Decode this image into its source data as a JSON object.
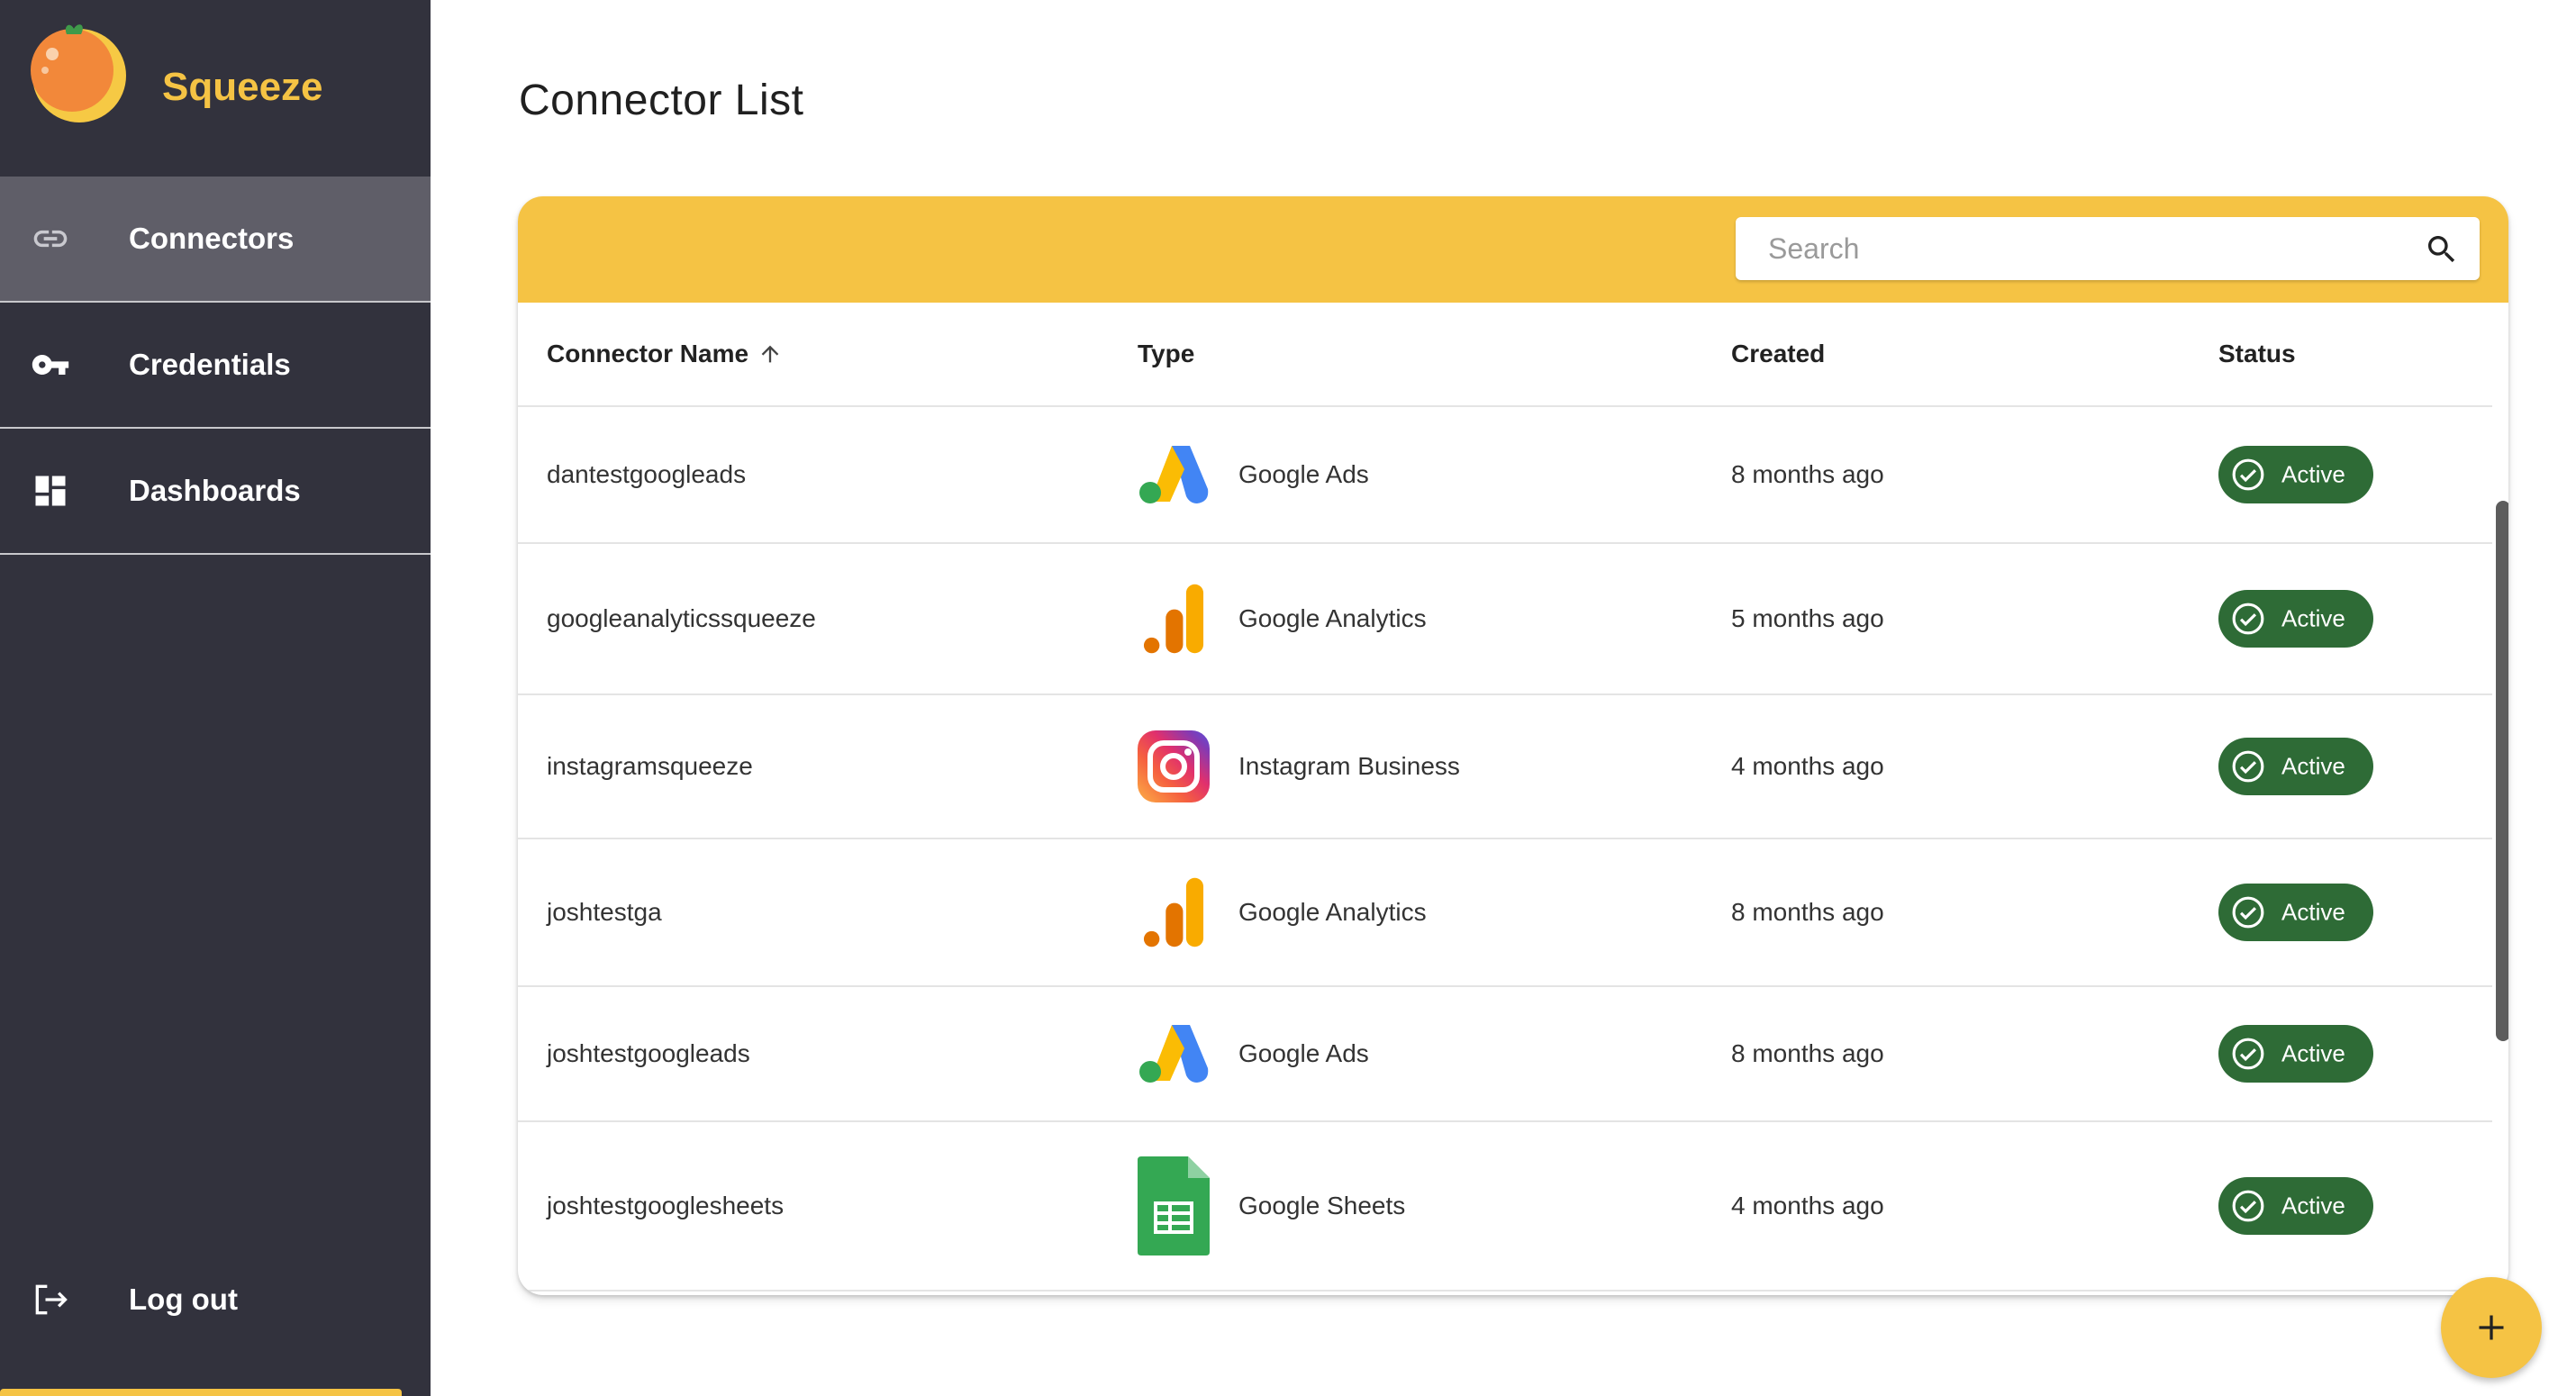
{
  "app": {
    "name": "Squeeze"
  },
  "colors": {
    "brand": "#f5c344",
    "sidebar": "#32323d",
    "sidebar_active": "#5f5e68",
    "status_active": "#2e6b36"
  },
  "sidebar": {
    "items": [
      {
        "label": "Connectors",
        "icon": "link-icon",
        "active": true
      },
      {
        "label": "Credentials",
        "icon": "key-icon",
        "active": false
      },
      {
        "label": "Dashboards",
        "icon": "dashboard-icon",
        "active": false
      }
    ],
    "logout": {
      "label": "Log out",
      "icon": "logout-icon"
    }
  },
  "page": {
    "title": "Connector List"
  },
  "search": {
    "placeholder": "Search",
    "value": ""
  },
  "table": {
    "columns": [
      "Connector Name",
      "Type",
      "Created",
      "Status"
    ],
    "sort": {
      "column": "Connector Name",
      "direction": "ascending"
    },
    "rows": [
      {
        "name": "dantestgoogleads",
        "type": "Google Ads",
        "type_icon": "google-ads-icon",
        "created": "8 months ago",
        "status": "Active"
      },
      {
        "name": "googleanalyticssqueeze",
        "type": "Google Analytics",
        "type_icon": "google-analytics-icon",
        "created": "5 months ago",
        "status": "Active"
      },
      {
        "name": "instagramsqueeze",
        "type": "Instagram Business",
        "type_icon": "instagram-icon",
        "created": "4 months ago",
        "status": "Active"
      },
      {
        "name": "joshtestga",
        "type": "Google Analytics",
        "type_icon": "google-analytics-icon",
        "created": "8 months ago",
        "status": "Active"
      },
      {
        "name": "joshtestgoogleads",
        "type": "Google Ads",
        "type_icon": "google-ads-icon",
        "created": "8 months ago",
        "status": "Active"
      },
      {
        "name": "joshtestgooglesheets",
        "type": "Google Sheets",
        "type_icon": "google-sheets-icon",
        "created": "4 months ago",
        "status": "Active"
      }
    ]
  },
  "fab": {
    "icon": "plus-icon"
  }
}
